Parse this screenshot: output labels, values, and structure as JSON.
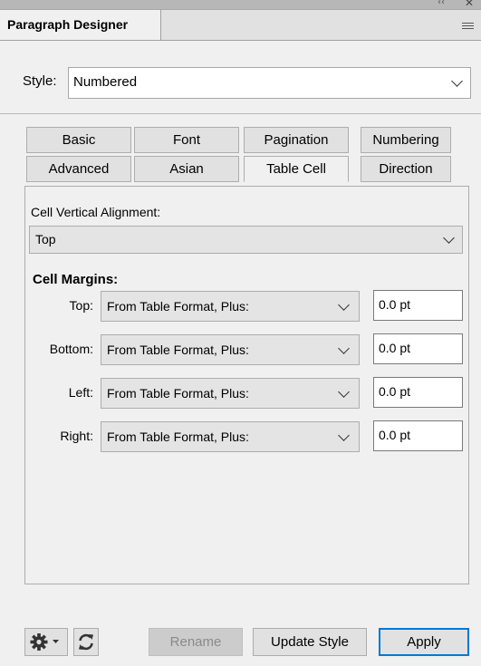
{
  "window": {
    "collapse_glyph": "‹‹",
    "close_glyph": "✕",
    "panel_tab": "Paragraph Designer",
    "menu_icon": "hamburger-menu-icon"
  },
  "style": {
    "label": "Style:",
    "value": "Numbered"
  },
  "tabs": {
    "row1": [
      "Basic",
      "Font",
      "Pagination",
      "Numbering"
    ],
    "row2": [
      "Advanced",
      "Asian",
      "Table Cell",
      "Direction"
    ],
    "active": "Table Cell"
  },
  "cell": {
    "vertical_alignment_label": "Cell Vertical Alignment:",
    "vertical_alignment_value": "Top",
    "margins_heading": "Cell Margins:",
    "margins": [
      {
        "label": "Top:",
        "source": "From Table Format, Plus:",
        "value": "0.0 pt"
      },
      {
        "label": "Bottom:",
        "source": "From Table Format, Plus:",
        "value": "0.0 pt"
      },
      {
        "label": "Left:",
        "source": "From Table Format, Plus:",
        "value": "0.0 pt"
      },
      {
        "label": "Right:",
        "source": "From Table Format, Plus:",
        "value": "0.0 pt"
      }
    ]
  },
  "buttons": {
    "gear_icon": "gear-icon",
    "refresh_icon": "refresh-icon",
    "rename": "Rename",
    "update_style": "Update Style",
    "apply": "Apply"
  },
  "colors": {
    "focus_border": "#0078d7",
    "panel_background": "#f0f0f0"
  }
}
